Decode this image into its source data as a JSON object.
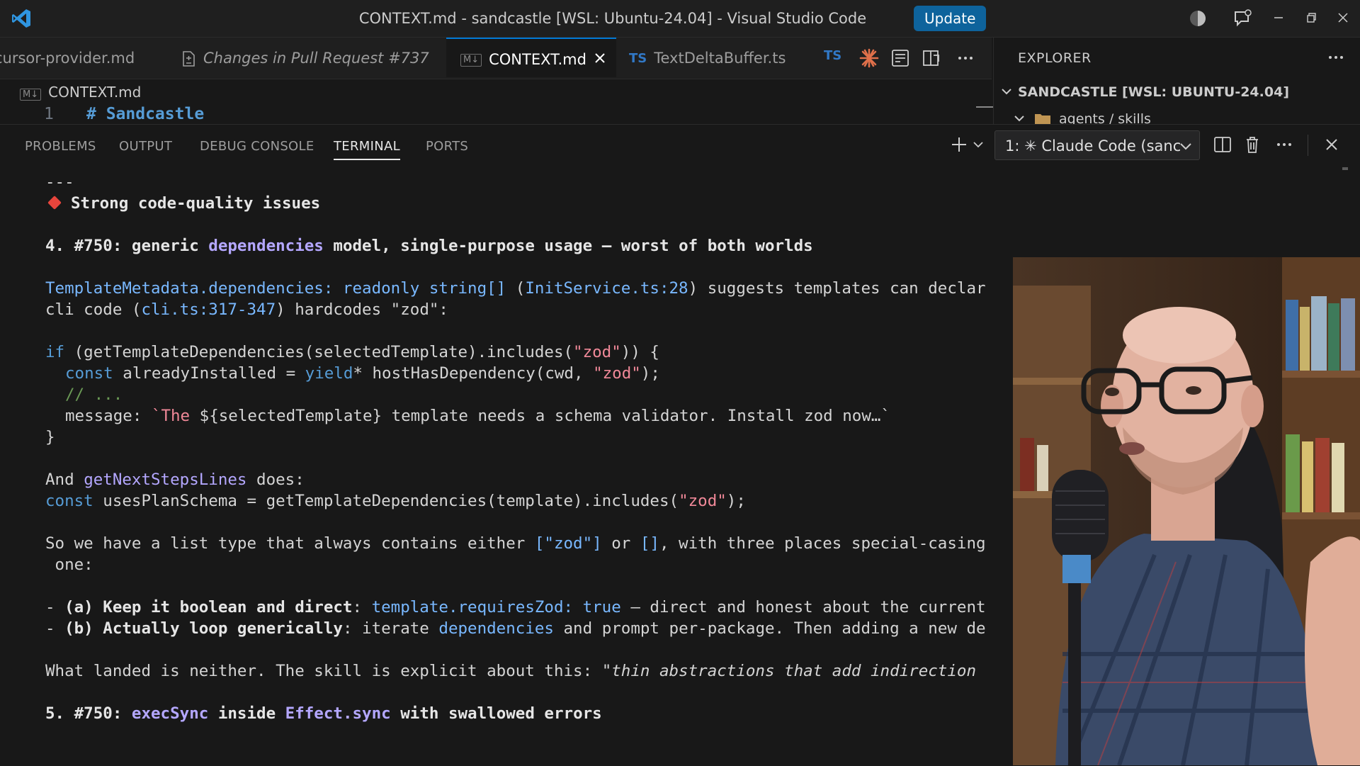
{
  "titlebar": {
    "title": "CONTEXT.md - sandcastle [WSL: Ubuntu-24.04] - Visual Studio Code",
    "update_label": "Update"
  },
  "tabs": [
    {
      "label": "cursor-provider.md",
      "icon": "markdown-icon"
    },
    {
      "label": "Changes in Pull Request #737",
      "icon": "diff-icon"
    },
    {
      "label": "CONTEXT.md",
      "icon": "markdown-icon",
      "active": true
    },
    {
      "label": "TextDeltaBuffer.ts",
      "icon": "typescript-icon"
    }
  ],
  "tab_badges": {
    "md": "M↓",
    "ts": "TS"
  },
  "breadcrumb": {
    "file": "CONTEXT.md"
  },
  "editor": {
    "line_number": "1",
    "line_text": "# Sandcastle"
  },
  "explorer": {
    "title": "EXPLORER",
    "root": "SANDCASTLE [WSL: UBUNTU-24.04]",
    "first_folder": "agents / skills"
  },
  "panel": {
    "tabs": [
      "PROBLEMS",
      "OUTPUT",
      "DEBUG CONSOLE",
      "TERMINAL",
      "PORTS"
    ],
    "active_tab": "TERMINAL",
    "terminal_select": "1: ✳ Claude Code (sanc"
  },
  "terminal": {
    "divider": "---",
    "heading": "Strong code-quality issues",
    "item4": {
      "a": "4. #750: generic ",
      "b": "dependencies",
      "c": " model, single-purpose usage — worst of both worlds"
    },
    "l_meta": {
      "a": "TemplateMetadata.dependencies: readonly string[]",
      "b": " (",
      "c": "InitService.ts:28",
      "d": ") suggests templates can declar"
    },
    "l_cli": {
      "a": "cli code (",
      "b": "cli.ts:317-347",
      "c": ") hardcodes \"zod\":"
    },
    "code1": {
      "a": "if",
      "b": " (getTemplateDependencies(selectedTemplate).includes(",
      "c": "\"zod\"",
      "d": ")) {"
    },
    "code2": {
      "a": "const",
      "b": " alreadyInstalled = ",
      "c": "yield",
      "d": "* hostHasDependency(cwd, ",
      "e": "\"zod\"",
      "f": ");"
    },
    "code3": "// ...",
    "code4": {
      "a": "message: ",
      "b": "`The",
      "c": " ${selectedTemplate} template needs a schema validator. Install zod now…`"
    },
    "code5": "}",
    "and": {
      "a": "And ",
      "b": "getNextStepsLines",
      "c": " does:"
    },
    "plan": {
      "a": "const",
      "b": " usesPlanSchema = getTemplateDependencies(template).includes(",
      "c": "\"zod\"",
      "d": ");"
    },
    "so": {
      "a": "So we have a list type that always contains either ",
      "b": "[\"zod\"]",
      "c": " or ",
      "d": "[]",
      "e": ", with three places special-casing"
    },
    "one": " one:",
    "opt_a": {
      "a": "- ",
      "b": "(a) Keep it boolean and direct",
      "c": ": ",
      "d": "template.requiresZod: true",
      "e": " — direct and honest about the current"
    },
    "opt_b": {
      "a": "- ",
      "b": "(b) Actually loop generically",
      "c": ": iterate ",
      "d": "dependencies",
      "e": " and prompt per-package. Then adding a new de"
    },
    "landed": {
      "a": "What landed is neither. The skill is explicit about this: ",
      "b": "\"thin abstractions that add indirection"
    },
    "item5": {
      "a": "5. #750: ",
      "b": "execSync",
      "c": " inside ",
      "d": "Effect.sync",
      "e": " with swallowed errors"
    }
  },
  "colors": {
    "accent": "#0078d4",
    "update_button": "#0e639c",
    "heading_diamond": "#e8453c"
  }
}
